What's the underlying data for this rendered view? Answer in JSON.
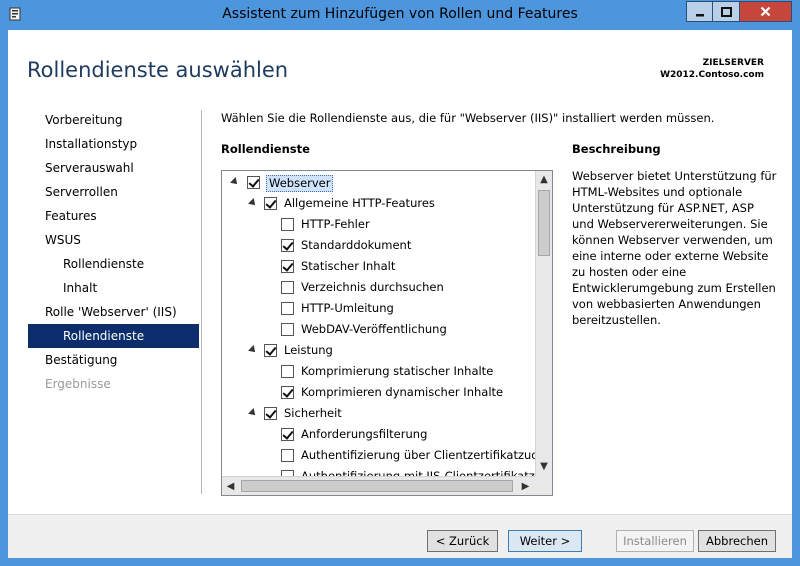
{
  "window": {
    "title": "Assistent zum Hinzufügen von Rollen und Features"
  },
  "page": {
    "heading": "Rollendienste auswählen",
    "server_label": "ZIELSERVER",
    "server_name": "W2012.Contoso.com",
    "instruction": "Wählen Sie die Rollendienste aus, die für \"Webserver (IIS)\" installiert werden müssen.",
    "roles_column_title": "Rollendienste",
    "description_title": "Beschreibung",
    "description_text": "Webserver bietet Unterstützung für HTML-Websites und optionale Unterstützung für ASP.NET, ASP und Webservererweiterungen. Sie können Webserver verwenden, um eine interne oder externe Website zu hosten oder eine Entwicklerumgebung zum Erstellen von webbasierten Anwendungen bereitzustellen."
  },
  "nav": {
    "items": [
      {
        "label": "Vorbereitung"
      },
      {
        "label": "Installationstyp"
      },
      {
        "label": "Serverauswahl"
      },
      {
        "label": "Serverrollen"
      },
      {
        "label": "Features"
      },
      {
        "label": "WSUS"
      },
      {
        "label": "Rollendienste"
      },
      {
        "label": "Inhalt"
      },
      {
        "label": "Rolle 'Webserver' (IIS)"
      },
      {
        "label": "Rollendienste"
      },
      {
        "label": "Bestätigung"
      },
      {
        "label": "Ergebnisse"
      }
    ]
  },
  "tree": {
    "rows": [
      {
        "label": "Webserver",
        "checked": true,
        "expanded": true,
        "selected": true
      },
      {
        "label": "Allgemeine HTTP-Features",
        "checked": true,
        "expanded": true
      },
      {
        "label": "HTTP-Fehler",
        "checked": false
      },
      {
        "label": "Standarddokument",
        "checked": true
      },
      {
        "label": "Statischer Inhalt",
        "checked": true
      },
      {
        "label": "Verzeichnis durchsuchen",
        "checked": false
      },
      {
        "label": "HTTP-Umleitung",
        "checked": false
      },
      {
        "label": "WebDAV-Veröffentlichung",
        "checked": false
      },
      {
        "label": "Leistung",
        "checked": true,
        "expanded": true
      },
      {
        "label": "Komprimierung statischer Inhalte",
        "checked": false
      },
      {
        "label": "Komprimieren dynamischer Inhalte",
        "checked": true
      },
      {
        "label": "Sicherheit",
        "checked": true,
        "expanded": true
      },
      {
        "label": "Anforderungsfilterung",
        "checked": true
      },
      {
        "label": "Authentifizierung über Clientzertifikatzuord",
        "checked": false
      },
      {
        "label": "Authentifizierung mit IIS-Clientzertifikatzuo",
        "checked": false
      }
    ]
  },
  "buttons": {
    "back": "< Zurück",
    "next": "Weiter >",
    "install": "Installieren",
    "cancel": "Abbrechen"
  },
  "colors": {
    "titlebar": "#4d95dd",
    "nav_active": "#0b2d6b",
    "close_button": "#c7463b",
    "heading": "#1e3a5f"
  }
}
